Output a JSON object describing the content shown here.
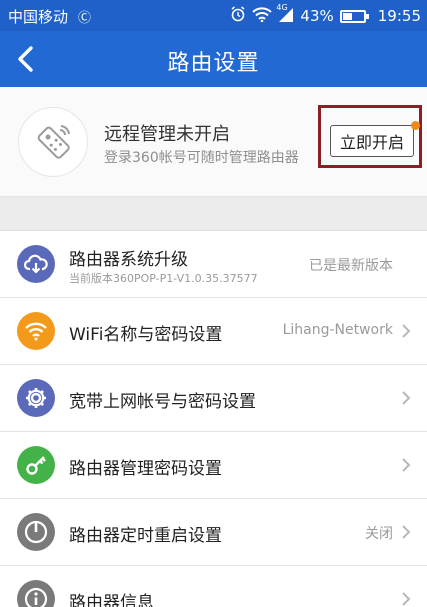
{
  "statusbar": {
    "carrier": "中国移动",
    "network_tag": "4G",
    "battery_percent": "43%",
    "battery_level": 0.43,
    "time": "19:55"
  },
  "appbar": {
    "title": "路由设置",
    "back_icon": "chevron-left-icon"
  },
  "remote": {
    "icon": "remote-control-icon",
    "title": "远程管理未开启",
    "subtitle": "登录360帐号可随时管理路由器",
    "enable_button": "立即开启"
  },
  "settings": [
    {
      "title": "路由器系统升级",
      "subtitle": "当前版本360POP-P1-V1.0.35.37577",
      "value": "已是最新版本",
      "icon": "cloud-download-icon",
      "color": "#5a69b9",
      "chevron": false
    },
    {
      "title": "WiFi名称与密码设置",
      "value": "Lihang-Network",
      "icon": "wifi-icon",
      "color": "#f39a1b",
      "chevron": true
    },
    {
      "title": "宽带上网帐号与密码设置",
      "value": "",
      "icon": "gear-icon",
      "color": "#5a69b9",
      "chevron": true
    },
    {
      "title": "路由器管理密码设置",
      "value": "",
      "icon": "key-icon",
      "color": "#43b248",
      "chevron": true
    },
    {
      "title": "路由器定时重启设置",
      "value": "关闭",
      "icon": "power-icon",
      "color": "#7a7a7a",
      "chevron": true
    },
    {
      "title": "路由器信息",
      "value": "",
      "icon": "info-icon",
      "color": "#7a7a7a",
      "chevron": true
    }
  ]
}
